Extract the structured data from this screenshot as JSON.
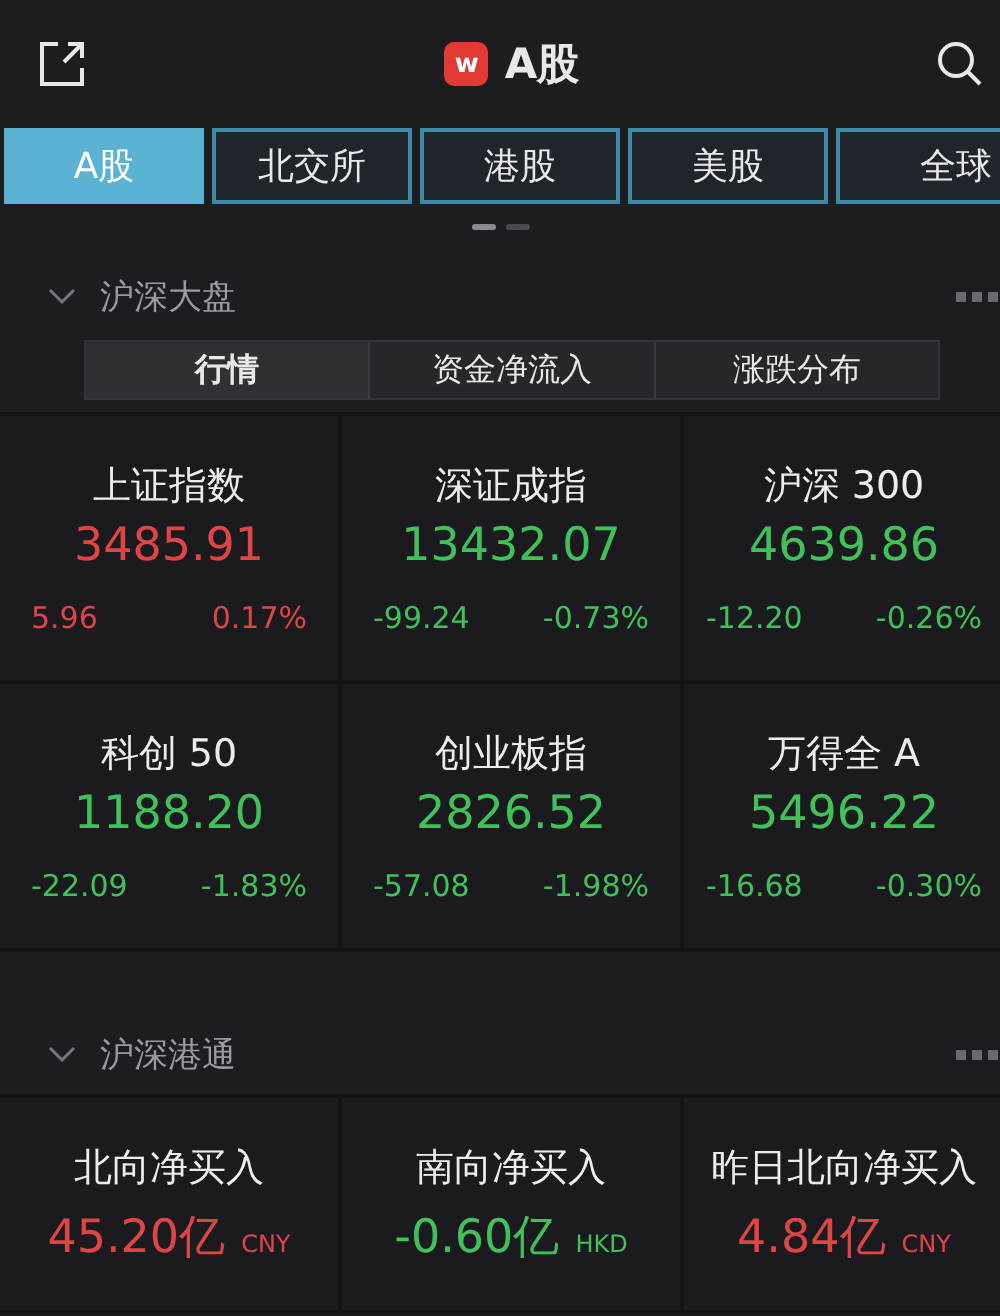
{
  "header": {
    "title": "A股",
    "logo": "w"
  },
  "market_tabs": [
    {
      "label": "A股",
      "selected": true
    },
    {
      "label": "北交所",
      "selected": false
    },
    {
      "label": "港股",
      "selected": false
    },
    {
      "label": "美股",
      "selected": false
    },
    {
      "label": "全球",
      "selected": false
    }
  ],
  "pager": [
    {
      "selected": true
    },
    {
      "selected": false
    }
  ],
  "sections": [
    {
      "title": "沪深大盘",
      "expanded": true,
      "segments": [
        {
          "label": "行情",
          "selected": true
        },
        {
          "label": "资金净流入",
          "selected": false
        },
        {
          "label": "涨跌分布",
          "selected": false
        }
      ],
      "cards": [
        {
          "name": "上证指数",
          "value": "3485.91",
          "change": "5.96",
          "percent": "0.17%",
          "color": "#e04545"
        },
        {
          "name": "深证成指",
          "value": "13432.07",
          "change": "-99.24",
          "percent": "-0.73%",
          "color": "#3fc25a"
        },
        {
          "name": "沪深 300",
          "value": "4639.86",
          "change": "-12.20",
          "percent": "-0.26%",
          "color": "#3fc25a"
        },
        {
          "name": "科创 50",
          "value": "1188.20",
          "change": "-22.09",
          "percent": "-1.83%",
          "color": "#3fc25a"
        },
        {
          "name": "创业板指",
          "value": "2826.52",
          "change": "-57.08",
          "percent": "-1.98%",
          "color": "#3fc25a"
        },
        {
          "name": "万得全 A",
          "value": "5496.22",
          "change": "-16.68",
          "percent": "-0.30%",
          "color": "#3fc25a"
        }
      ]
    },
    {
      "title": "沪深港通",
      "expanded": true,
      "cards": [
        {
          "name": "北向净买入",
          "value": "45.20亿",
          "unit": "CNY",
          "color": "#e04545"
        },
        {
          "name": "南向净买入",
          "value": "-0.60亿",
          "unit": "HKD",
          "color": "#3fc25a"
        },
        {
          "name": "昨日北向净买入",
          "value": "4.84亿",
          "unit": "CNY",
          "color": "#e04545"
        }
      ]
    }
  ]
}
